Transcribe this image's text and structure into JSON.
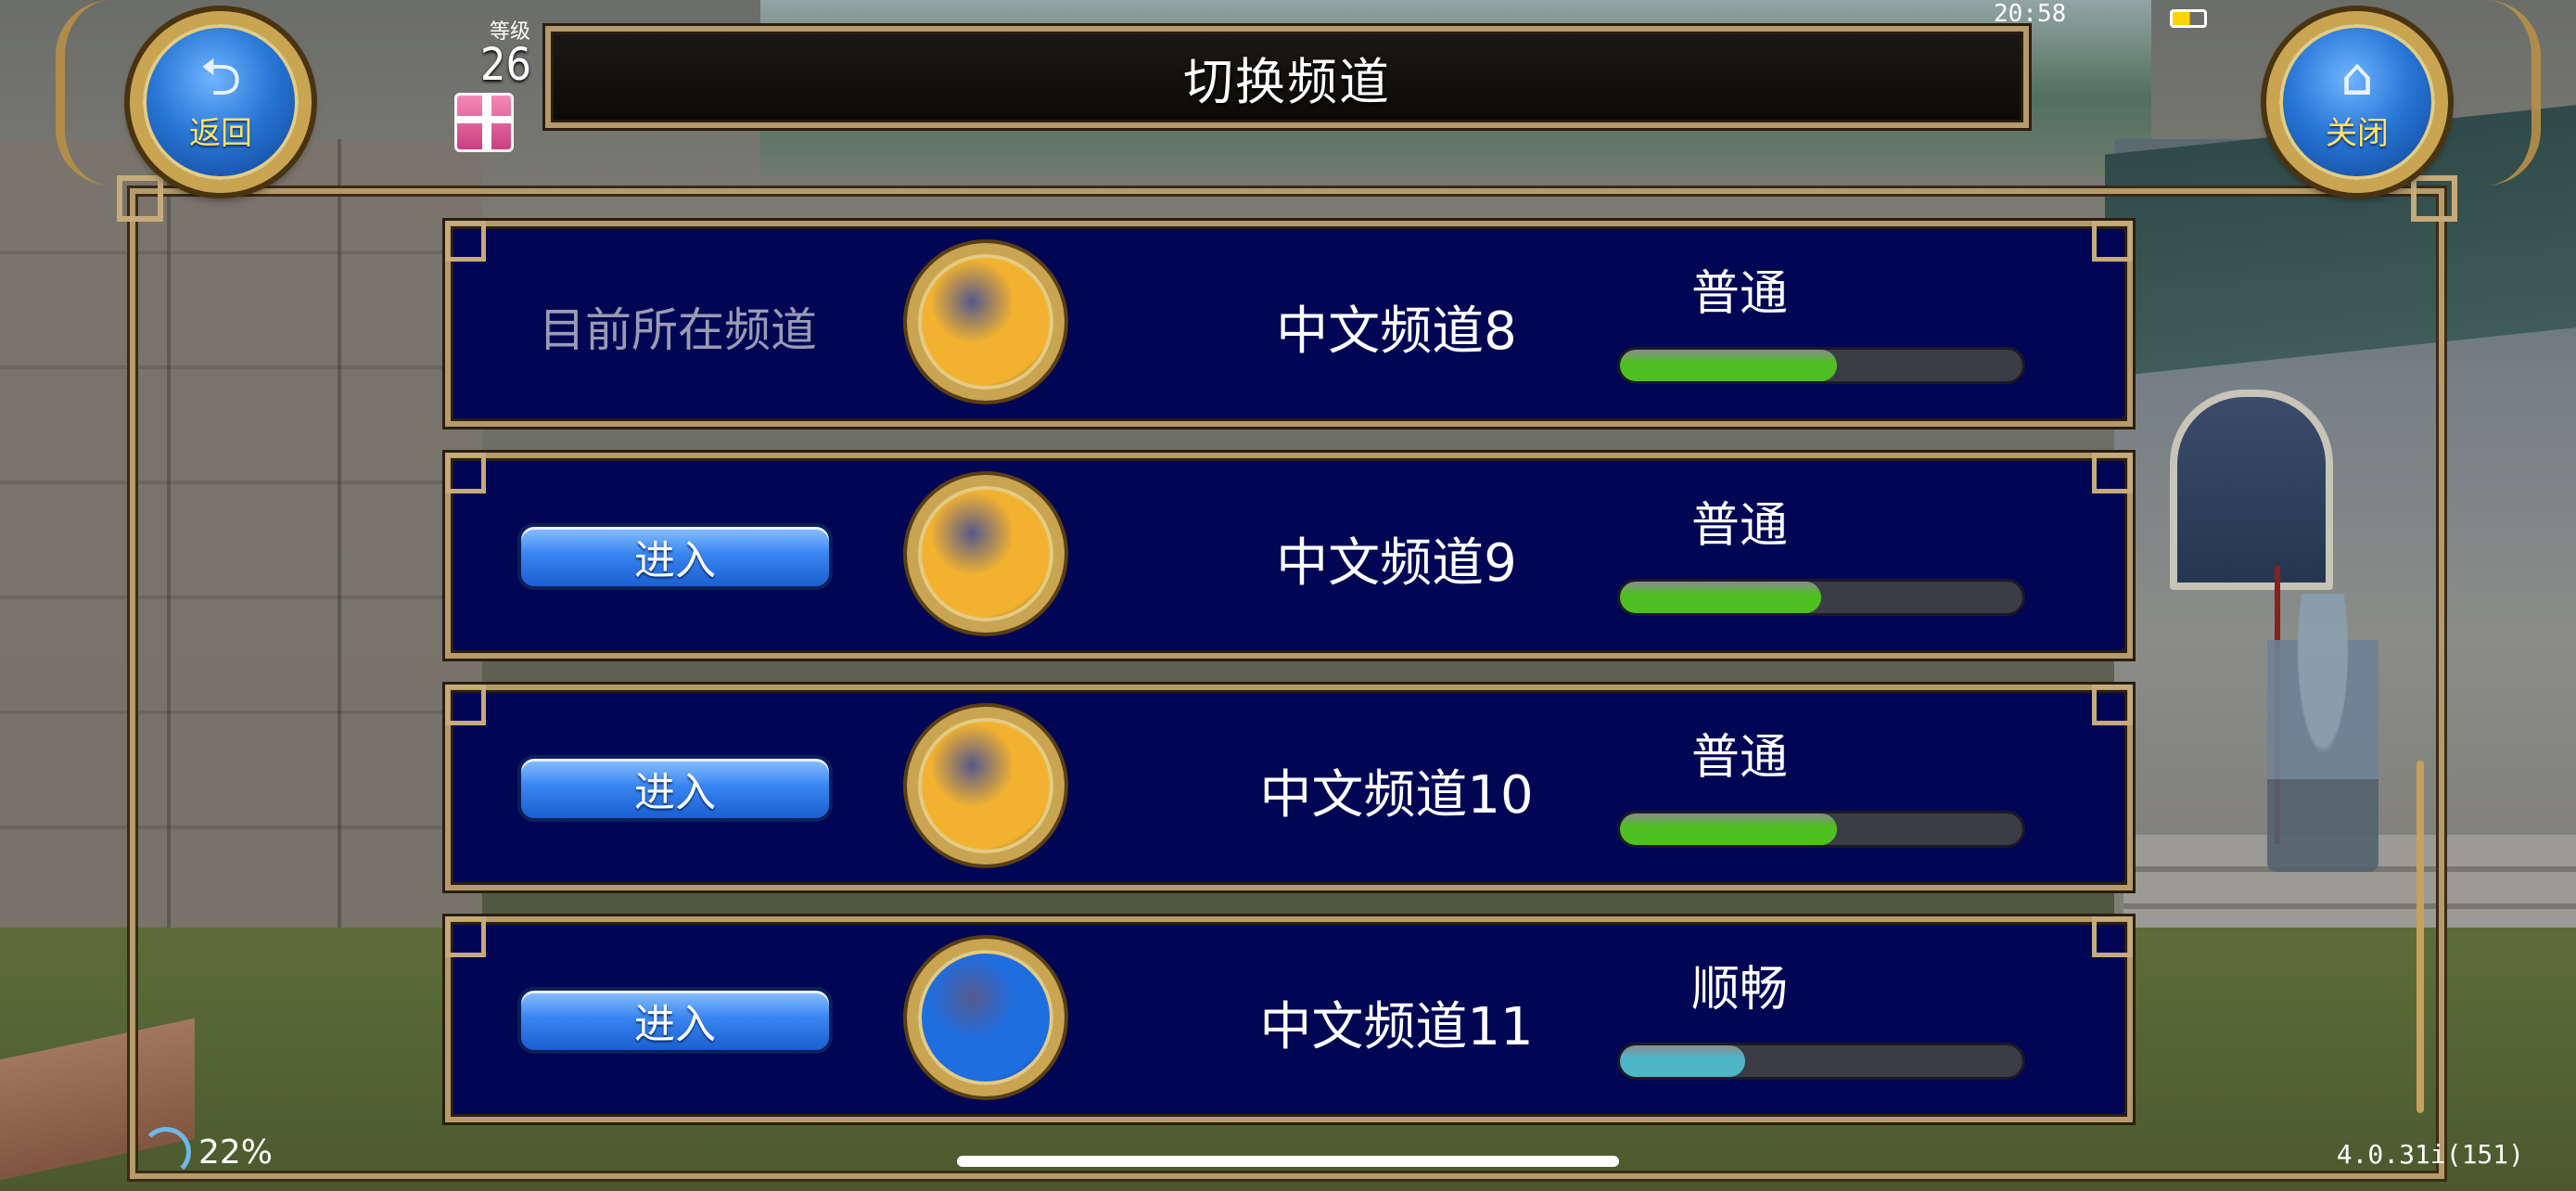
{
  "header": {
    "title": "切换频道",
    "back_label": "返回",
    "close_label": "关闭"
  },
  "player": {
    "level_label": "等级",
    "level": "26"
  },
  "status": {
    "time": "20:58"
  },
  "channels": [
    {
      "current_label": "目前所在频道",
      "name": "中文频道8",
      "load": "普通",
      "load_fraction": 0.54,
      "orb_color": "#f2b230",
      "bar_color": "#4fbf22",
      "is_current": true
    },
    {
      "enter_label": "进入",
      "name": "中文频道9",
      "load": "普通",
      "load_fraction": 0.5,
      "orb_color": "#f2b230",
      "bar_color": "#4fbf22",
      "is_current": false
    },
    {
      "enter_label": "进入",
      "name": "中文频道10",
      "load": "普通",
      "load_fraction": 0.54,
      "orb_color": "#f2b230",
      "bar_color": "#4fbf22",
      "is_current": false
    },
    {
      "enter_label": "进入",
      "name": "中文频道11",
      "load": "顺畅",
      "load_fraction": 0.31,
      "orb_color": "#1f6ee0",
      "bar_color": "#4fb6c8",
      "is_current": false
    }
  ],
  "footer": {
    "signal": "22%",
    "version": "4.0.31i(151)"
  },
  "icons": {
    "back": "back-arrow-icon",
    "close": "home-icon",
    "gift": "gift-icon",
    "signal": "signal-icon",
    "battery": "battery-icon"
  }
}
